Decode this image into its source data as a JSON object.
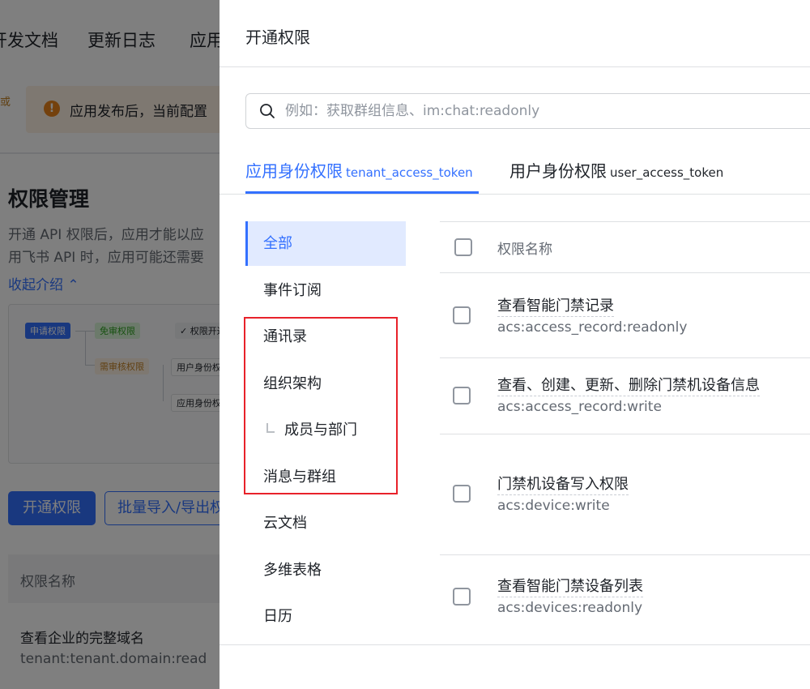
{
  "background": {
    "nav": [
      "开发文档",
      "更新日志",
      "应用"
    ],
    "left_badge": "或",
    "banner_text": "应用发布后，当前配置",
    "banner_icon": "!",
    "title": "权限管理",
    "desc_line1": "开通 API 权限后，应用才能以应",
    "desc_line2": "用飞书 API 时，应用可能还需要",
    "collapse_link": "收起介绍 ⌃",
    "diagram": {
      "apply": "申请权限",
      "free": "免审权限",
      "opened": "✓ 权限开通",
      "review": "需审核权限",
      "user_id": "用户身份权",
      "app_id": "应用身份权"
    },
    "btn_open": "开通权限",
    "btn_batch": "批量导入/导出权",
    "table_header": "权限名称",
    "row_name": "查看企业的完整域名",
    "row_key": "tenant:tenant.domain:read"
  },
  "drawer": {
    "title": "开通权限",
    "search": {
      "placeholder": "例如：获取群组信息、im:chat:readonly",
      "icon": "search-icon"
    },
    "tabs": [
      {
        "label": "应用身份权限",
        "token": "tenant_access_token",
        "active": true
      },
      {
        "label": "用户身份权限",
        "token": "user_access_token",
        "active": false
      }
    ],
    "categories": [
      {
        "label": "全部",
        "active": true
      },
      {
        "label": "事件订阅"
      },
      {
        "label": "通讯录"
      },
      {
        "label": "组织架构"
      },
      {
        "label": "成员与部门",
        "sub": true
      },
      {
        "label": "消息与群组"
      },
      {
        "label": "云文档"
      },
      {
        "label": "多维表格"
      },
      {
        "label": "日历"
      }
    ],
    "table": {
      "header": "权限名称",
      "rows": [
        {
          "name": "查看智能门禁记录",
          "key": "acs:access_record:readonly"
        },
        {
          "name": "查看、创建、更新、删除门禁机设备信息",
          "key": "acs:access_record:write"
        },
        {
          "name": "门禁机设备写入权限",
          "key": "acs:device:write"
        },
        {
          "name": "查看智能门禁设备列表",
          "key": "acs:devices:readonly"
        }
      ]
    }
  },
  "colors": {
    "accent": "#3370ff",
    "highlight": "#e8222a",
    "overlay": "rgba(0,0,0,0.5)"
  }
}
